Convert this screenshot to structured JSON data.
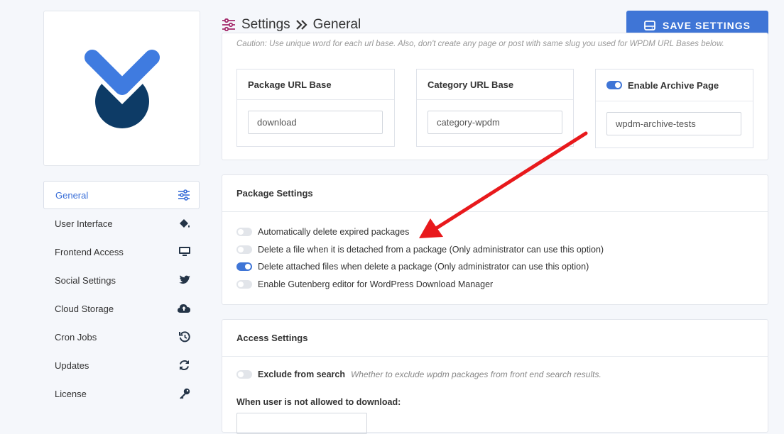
{
  "header": {
    "title_part1": "Settings",
    "title_part2": "General",
    "save_label": "SAVE SETTINGS"
  },
  "sidebar": {
    "items": [
      {
        "label": "General",
        "icon": "sliders-icon",
        "active": true
      },
      {
        "label": "User Interface",
        "icon": "paint-bucket-icon"
      },
      {
        "label": "Frontend Access",
        "icon": "desktop-icon"
      },
      {
        "label": "Social Settings",
        "icon": "twitter-icon"
      },
      {
        "label": "Cloud Storage",
        "icon": "cloud-upload-icon"
      },
      {
        "label": "Cron Jobs",
        "icon": "history-icon"
      },
      {
        "label": "Updates",
        "icon": "sync-icon"
      },
      {
        "label": "License",
        "icon": "key-icon"
      }
    ]
  },
  "url_settings": {
    "caution": "Caution: Use unique word for each url base. Also, don't create any page or post with same slug you used for WPDM URL Bases below.",
    "package_url": {
      "label": "Package URL Base",
      "value": "download"
    },
    "category_url": {
      "label": "Category URL Base",
      "value": "category-wpdm"
    },
    "archive": {
      "label": "Enable Archive Page",
      "value": "wpdm-archive-tests",
      "enabled": true
    }
  },
  "package_settings": {
    "title": "Package Settings",
    "options": [
      {
        "label": "Automatically delete expired packages",
        "enabled": false
      },
      {
        "label": "Delete a file when it is detached from a package (Only administrator can use this option)",
        "enabled": false
      },
      {
        "label": "Delete attached files when delete a package (Only administrator can use this option)",
        "enabled": true
      },
      {
        "label": "Enable Gutenberg editor for WordPress Download Manager",
        "enabled": false
      }
    ]
  },
  "access_settings": {
    "title": "Access Settings",
    "exclude_label": "Exclude from search",
    "exclude_hint": "Whether to exclude wpdm packages from front end search results.",
    "exclude_enabled": false,
    "not_allowed_label": "When user is not allowed to download:"
  },
  "colors": {
    "accent": "#3f75d6",
    "logo_light": "#3f7be0",
    "logo_dark": "#0d3b66",
    "annotation_arrow": "#e8191c"
  }
}
